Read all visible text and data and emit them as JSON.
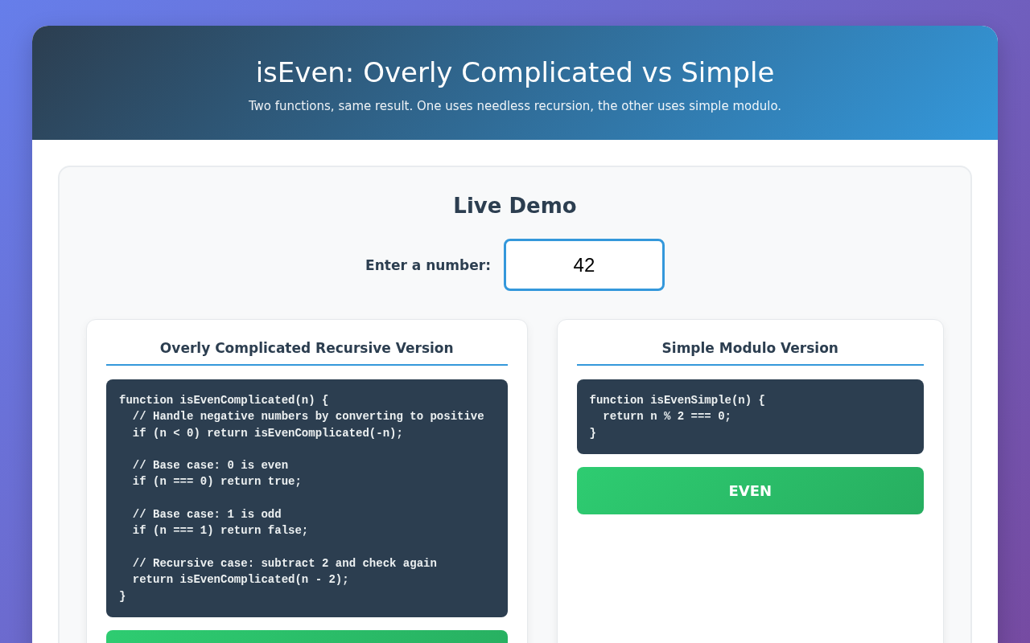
{
  "header": {
    "title": "isEven: Overly Complicated vs Simple",
    "subtitle": "Two functions, same result. One uses needless recursion, the other uses simple modulo."
  },
  "demo": {
    "heading": "Live Demo",
    "input": {
      "label": "Enter a number:",
      "value": "42"
    }
  },
  "panels": [
    {
      "heading": "Overly Complicated Recursive Version",
      "code": "function isEvenComplicated(n) {\n  // Handle negative numbers by converting to positive\n  if (n < 0) return isEvenComplicated(-n);\n\n  // Base case: 0 is even\n  if (n === 0) return true;\n\n  // Base case: 1 is odd\n  if (n === 1) return false;\n\n  // Recursive case: subtract 2 and check again\n  return isEvenComplicated(n - 2);\n}",
      "result": {
        "kind": "even"
      }
    },
    {
      "heading": "Simple Modulo Version",
      "code": "function isEvenSimple(n) {\n  return n % 2 === 0;\n}",
      "result": {
        "kind": "even",
        "label": "EVEN"
      }
    }
  ]
}
